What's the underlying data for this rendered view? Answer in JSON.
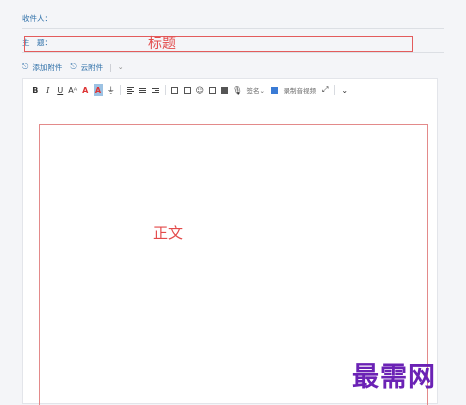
{
  "compose": {
    "recipient_label": "收件人：",
    "subject_label": "主　题：",
    "subject_annotation": "标题",
    "body_annotation": "正文"
  },
  "attachments": {
    "add_attachment": "添加附件",
    "cloud_attachment": "云附件",
    "separator": "|"
  },
  "toolbar": {
    "bold": "B",
    "italic": "I",
    "underline": "U",
    "font_size": "Aᴬ",
    "font_color": "A",
    "highlight": "A",
    "signature_label": "签名",
    "record_label": "录制音视频"
  },
  "watermark": "最需网",
  "colors": {
    "link": "#2d6fa8",
    "annotation": "#e34a4a",
    "watermark": "#6b22b5"
  }
}
